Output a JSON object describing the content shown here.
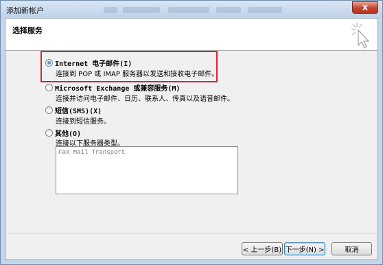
{
  "window": {
    "title": "添加新帐户",
    "close_label": "X"
  },
  "header": {
    "title": "选择服务"
  },
  "options": [
    {
      "label": "Internet 电子邮件(I)",
      "description": "连接到 POP 或 IMAP 服务器以发送和接收电子邮件。",
      "selected": true
    },
    {
      "label": "Microsoft Exchange 或兼容服务(M)",
      "description": "连接并访问电子邮件、日历、联系人、传真以及语音邮件。",
      "selected": false
    },
    {
      "label": "短信(SMS)(X)",
      "description": "连接到短信服务。",
      "selected": false
    },
    {
      "label": "其他(O)",
      "description": "连接以下服务器类型。",
      "selected": false
    }
  ],
  "other_server_types": [
    "Fax Mail Transport"
  ],
  "footer": {
    "back_label": "< 上一步(B)",
    "next_label": "下一步(N) >",
    "cancel_label": "取消"
  },
  "colors": {
    "highlight": "#e2202b"
  }
}
